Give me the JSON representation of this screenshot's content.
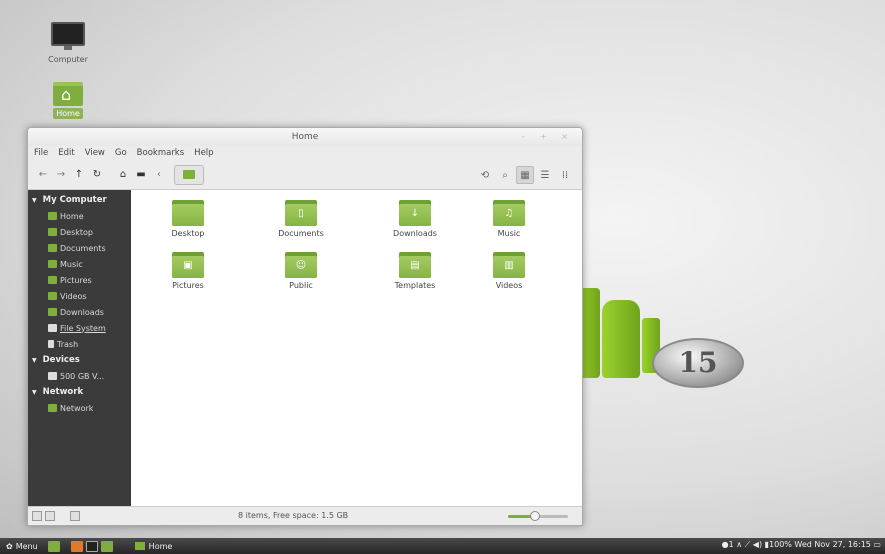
{
  "desktop": {
    "icons": [
      {
        "label": "Computer",
        "icon": "computer-icon"
      },
      {
        "label": "Home",
        "icon": "home-folder-icon"
      }
    ],
    "badge_text": "15"
  },
  "window": {
    "title": "Home",
    "controls": "– + ×",
    "menu": [
      "File",
      "Edit",
      "View",
      "Go",
      "Bookmarks",
      "Help"
    ],
    "toolbar": {
      "back_icon": "←",
      "forward_icon": "→",
      "up_icon": "↑",
      "reload_icon": "↻",
      "home_icon": "⌂",
      "computer_icon": "▬",
      "crumb_left": "‹",
      "toggle_icon": "⟲",
      "search_icon": "⌕",
      "icon_view": "▦",
      "list_view": "☰",
      "compact_view": "⁞⁞"
    },
    "sidebar": {
      "sections": [
        {
          "title": "My Computer",
          "items": [
            "Home",
            "Desktop",
            "Documents",
            "Music",
            "Pictures",
            "Videos",
            "Downloads",
            "File System",
            "Trash"
          ]
        },
        {
          "title": "Devices",
          "items": [
            "500 GB V..."
          ]
        },
        {
          "title": "Network",
          "items": [
            "Network"
          ]
        }
      ]
    },
    "files": [
      {
        "name": "Desktop",
        "emblem": ""
      },
      {
        "name": "Documents",
        "emblem": "▯"
      },
      {
        "name": "Downloads",
        "emblem": "↓"
      },
      {
        "name": "Music",
        "emblem": "♫"
      },
      {
        "name": "Pictures",
        "emblem": "▣"
      },
      {
        "name": "Public",
        "emblem": "☺"
      },
      {
        "name": "Templates",
        "emblem": "▤"
      },
      {
        "name": "Videos",
        "emblem": "▥"
      }
    ],
    "status": "8 items, Free space: 1.5 GB",
    "zoom_level": 0.45
  },
  "taskbar": {
    "menu_label": "Menu",
    "window_label": "Home",
    "tray": "●1 ∧ ⟋ ◀) ▮100% Wed Nov 27, 16:15 ▭"
  }
}
